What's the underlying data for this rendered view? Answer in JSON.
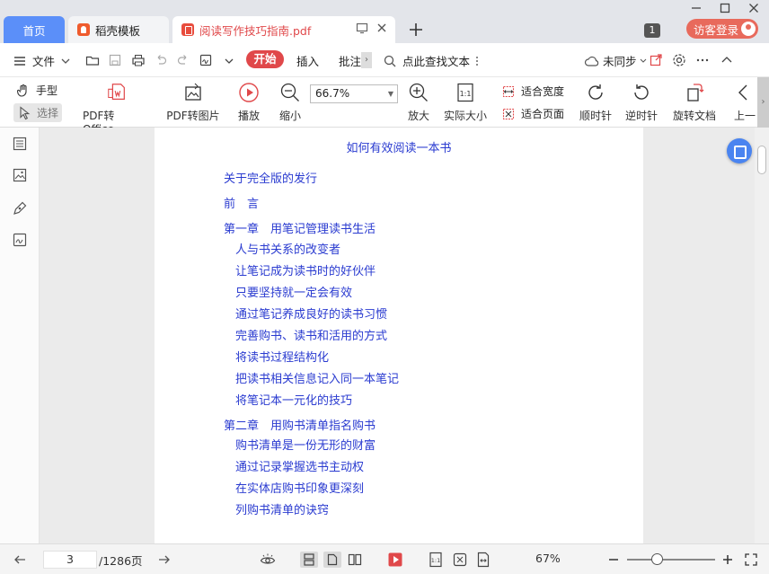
{
  "titlebar": {
    "tabs": [
      {
        "label": "首页"
      },
      {
        "label": "稻壳模板"
      },
      {
        "label": "阅读写作技巧指南.pdf"
      }
    ],
    "badge": "1",
    "login_label": "访客登录"
  },
  "menubar": {
    "file_label": "文件",
    "start_label": "开始",
    "insert_label": "插入",
    "annotate_label": "批注",
    "search_label": "点此查找文本",
    "sync_label": "未同步"
  },
  "toolbar": {
    "hand_label": "手型",
    "select_label": "选择",
    "pdf_office_label": "PDF转Office",
    "pdf_image_label": "PDF转图片",
    "play_label": "播放",
    "zoom_out_label": "缩小",
    "zoom_value": "66.7%",
    "zoom_in_label": "放大",
    "actual_size_label": "实际大小",
    "fit_width_label": "适合宽度",
    "fit_page_label": "适合页面",
    "rotate_cw_label": "顺时针",
    "rotate_ccw_label": "逆时针",
    "rotate_doc_label": "旋转文档",
    "prev_label": "上一"
  },
  "document": {
    "title": "如何有效阅读一本书",
    "toc": [
      "关于完全版的发行",
      "前　言",
      "第一章　用笔记管理读书生活",
      "人与书关系的改变者",
      "让笔记成为读书时的好伙伴",
      "只要坚持就一定会有效",
      "通过笔记养成良好的读书习惯",
      "完善购书、读书和活用的方式",
      "将读书过程结构化",
      "把读书相关信息记入同一本笔记",
      "将笔记本一元化的技巧",
      "第二章　用购书清单指名购书",
      "购书清单是一份无形的财富",
      "通过记录掌握选书主动权",
      "在实体店购书印象更深刻",
      "列购书清单的诀窍"
    ]
  },
  "statusbar": {
    "current_page": "3",
    "total_pages": "/1286页",
    "zoom_percent": "67%"
  }
}
